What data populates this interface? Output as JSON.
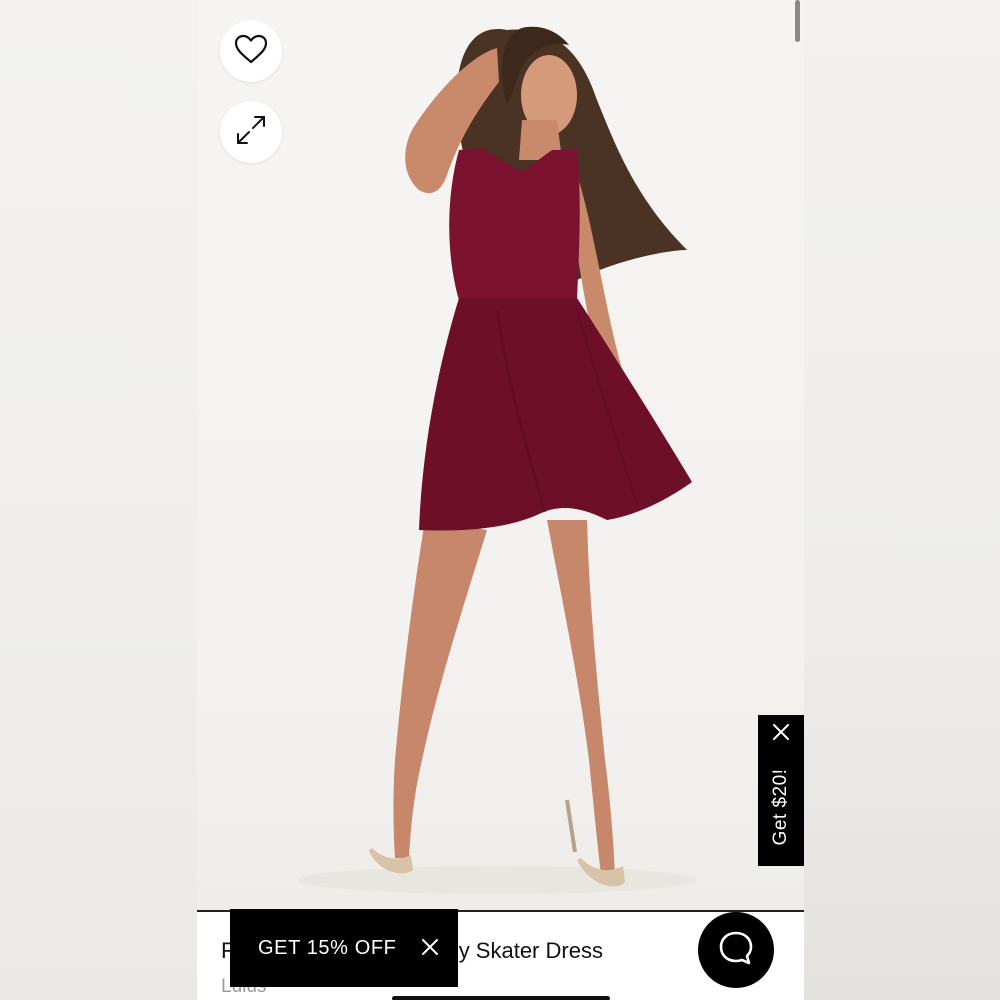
{
  "product": {
    "title": "Lulus Skater Dress",
    "title_visible_fragment": "dy Skater Dress",
    "title_initial": "F",
    "brand": "Lulus"
  },
  "actions": {
    "wishlist_icon": "heart-outline-icon",
    "expand_icon": "expand-arrows-icon"
  },
  "promo_tab": {
    "label": "Get $20!",
    "close_icon": "close-icon"
  },
  "discount_banner": {
    "label": "GET 15% OFF",
    "close_icon": "close-icon"
  },
  "chat": {
    "icon": "chat-bubble-icon"
  },
  "colors": {
    "dress": "#7a1230",
    "banner_bg": "#000000",
    "banner_text": "#ffffff",
    "brand_text": "#9a9a9a"
  }
}
